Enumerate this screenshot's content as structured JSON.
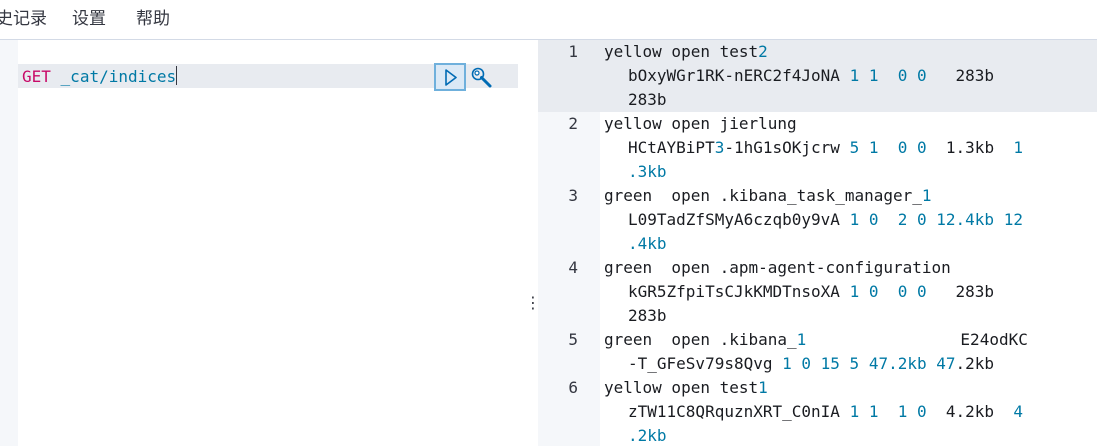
{
  "menu": {
    "history": "史记录",
    "settings": "设置",
    "help": "帮助"
  },
  "request": {
    "method": "GET",
    "path": "_cat/indices"
  },
  "output": {
    "line_numbers": [
      "1",
      "2",
      "3",
      "4",
      "5",
      "6"
    ],
    "lines": [
      [
        "yellow open test",
        "2"
      ],
      [
        "bOxyWGr1RK-nERC2f4JoNA ",
        "1 1  0 0",
        "   283b"
      ],
      [
        "283b"
      ],
      [
        "yellow open jierlung"
      ],
      [
        "HCtAYBiPT",
        "3",
        "-1hG1sOKjcrw ",
        "5 1  0 0",
        "  1.3kb  ",
        "1"
      ],
      [
        ".3kb"
      ],
      [
        "green  open .kibana_task_manager_",
        "1"
      ],
      [
        "L09TadZfSMyA6czqb0y9vA ",
        "1 0  2 0 12.4kb 12"
      ],
      [
        ".4kb"
      ],
      [
        "green  open .apm-agent-configuration"
      ],
      [
        "kGR5ZfpiTsCJkKMDTnsoXA ",
        "1 0  0 0",
        "   283b"
      ],
      [
        "283b"
      ],
      [
        "green  open .kibana_",
        "1",
        "                E24odKC"
      ],
      [
        "-T_GFeSv79s8Qvg ",
        "1 0 15 5 47.2kb 47",
        ".2kb"
      ],
      [
        "yellow open test",
        "1"
      ],
      [
        "zTW11C8QRquznXRT_C0nIA ",
        "1 1  1 0",
        "  4.2kb  ",
        "4"
      ],
      [
        ".2kb"
      ]
    ]
  }
}
